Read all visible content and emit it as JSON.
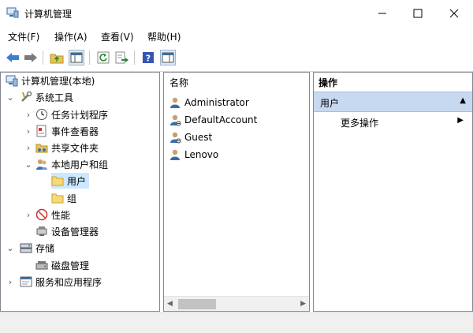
{
  "window": {
    "title": "计算机管理",
    "minimize_icon": "minimize-icon",
    "maximize_icon": "maximize-icon",
    "close_icon": "close-icon"
  },
  "menu": [
    "文件(F)",
    "操作(A)",
    "查看(V)",
    "帮助(H)"
  ],
  "toolbar": {
    "icons": [
      "back-arrow-icon",
      "forward-arrow-icon",
      "up-folder-icon",
      "show-hide-tree-icon",
      "refresh-icon",
      "export-list-icon",
      "help-icon",
      "properties-pane-icon"
    ]
  },
  "tree": {
    "root": "计算机管理(本地)",
    "system_tools": "系统工具",
    "task_scheduler": "任务计划程序",
    "event_viewer": "事件查看器",
    "shared_folders": "共享文件夹",
    "local_users": "本地用户和组",
    "users": "用户",
    "groups": "组",
    "performance": "性能",
    "device_manager": "设备管理器",
    "storage": "存储",
    "disk_management": "磁盘管理",
    "services_apps": "服务和应用程序"
  },
  "list": {
    "header": "名称",
    "items": [
      "Administrator",
      "DefaultAccount",
      "Guest",
      "Lenovo"
    ]
  },
  "actions": {
    "header": "操作",
    "section": "用户",
    "more": "更多操作"
  },
  "colors": {
    "selection": "#cce8ff",
    "actions_section": "#c7d9f0",
    "accent": "#2b6dbf"
  }
}
